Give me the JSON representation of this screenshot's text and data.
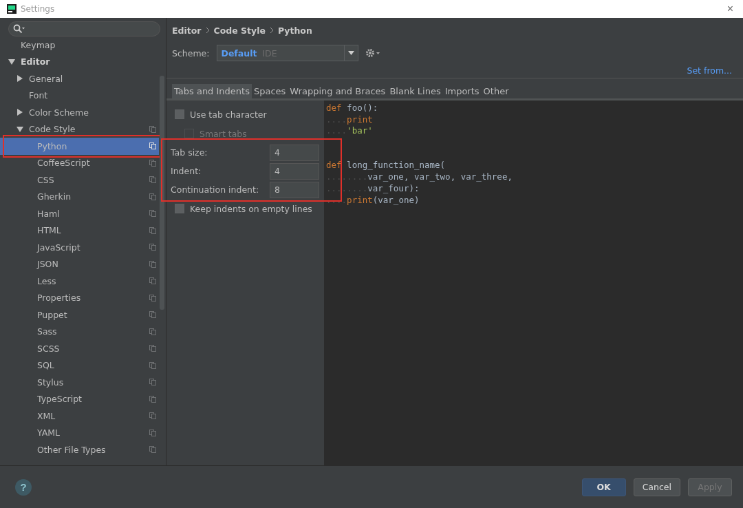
{
  "window": {
    "title": "Settings",
    "close": "×"
  },
  "breadcrumb": [
    "Editor",
    "Code Style",
    "Python"
  ],
  "scheme": {
    "label": "Scheme:",
    "value": "Default",
    "suffix": "IDE",
    "link": "Set from..."
  },
  "tree": [
    {
      "label": "Keymap",
      "selected": false,
      "highlighted": false,
      "modified": false
    },
    {
      "label": "Editor",
      "selected": false,
      "highlighted": false,
      "modified": false,
      "expanded": true,
      "children": [
        {
          "label": "General",
          "selected": false,
          "highlighted": false,
          "modified": false,
          "expanded": false
        },
        {
          "label": "Font",
          "selected": false,
          "highlighted": false,
          "modified": false
        },
        {
          "label": "Color Scheme",
          "selected": false,
          "highlighted": false,
          "modified": false,
          "expanded": false
        },
        {
          "label": "Code Style",
          "selected": false,
          "highlighted": false,
          "modified": true,
          "expanded": true,
          "children": [
            {
              "label": "Python",
              "selected": true,
              "highlighted": true,
              "modified": true
            },
            {
              "label": "CoffeeScript",
              "selected": false,
              "highlighted": false,
              "modified": true
            },
            {
              "label": "CSS",
              "selected": false,
              "highlighted": false,
              "modified": true
            },
            {
              "label": "Gherkin",
              "selected": false,
              "highlighted": false,
              "modified": true
            },
            {
              "label": "Haml",
              "selected": false,
              "highlighted": false,
              "modified": true
            },
            {
              "label": "HTML",
              "selected": false,
              "highlighted": false,
              "modified": true
            },
            {
              "label": "JavaScript",
              "selected": false,
              "highlighted": false,
              "modified": true
            },
            {
              "label": "JSON",
              "selected": false,
              "highlighted": false,
              "modified": true
            },
            {
              "label": "Less",
              "selected": false,
              "highlighted": false,
              "modified": true
            },
            {
              "label": "Properties",
              "selected": false,
              "highlighted": false,
              "modified": true
            },
            {
              "label": "Puppet",
              "selected": false,
              "highlighted": false,
              "modified": true
            },
            {
              "label": "Sass",
              "selected": false,
              "highlighted": false,
              "modified": true
            },
            {
              "label": "SCSS",
              "selected": false,
              "highlighted": false,
              "modified": true
            },
            {
              "label": "SQL",
              "selected": false,
              "highlighted": false,
              "modified": true
            },
            {
              "label": "Stylus",
              "selected": false,
              "highlighted": false,
              "modified": true
            },
            {
              "label": "TypeScript",
              "selected": false,
              "highlighted": false,
              "modified": true
            },
            {
              "label": "XML",
              "selected": false,
              "highlighted": false,
              "modified": true
            },
            {
              "label": "YAML",
              "selected": false,
              "highlighted": false,
              "modified": true
            },
            {
              "label": "Other File Types",
              "selected": false,
              "highlighted": false,
              "modified": true
            }
          ]
        }
      ]
    }
  ],
  "tabs": [
    {
      "label": "Tabs and Indents",
      "selected": true
    },
    {
      "label": "Spaces",
      "selected": false
    },
    {
      "label": "Wrapping and Braces",
      "selected": false
    },
    {
      "label": "Blank Lines",
      "selected": false
    },
    {
      "label": "Imports",
      "selected": false
    },
    {
      "label": "Other",
      "selected": false
    }
  ],
  "options_top": [
    {
      "label": "Use tab character",
      "checked": false,
      "disabled": false,
      "nested": false
    },
    {
      "label": "Smart tabs",
      "checked": false,
      "disabled": true,
      "nested": true
    }
  ],
  "indent_fields": {
    "highlighted": true,
    "fields": [
      {
        "label": "Tab size:",
        "value": "4"
      },
      {
        "label": "Indent:",
        "value": "4"
      },
      {
        "label": "Continuation indent:",
        "value": "8"
      }
    ]
  },
  "options_bottom": [
    {
      "label": "Keep indents on empty lines",
      "checked": false,
      "disabled": false,
      "nested": false
    }
  ],
  "code": [
    [
      [
        {
          "kind": "keyword",
          "text": "def"
        },
        {
          "kind": "plain",
          "text": " foo():"
        }
      ],
      [
        {
          "kind": "space",
          "text": "...."
        },
        {
          "kind": "keyword",
          "text": "print"
        }
      ],
      [
        {
          "kind": "space",
          "text": "...."
        },
        {
          "kind": "string",
          "text": "'bar'"
        }
      ]
    ],
    [
      [
        {
          "kind": "keyword",
          "text": "def"
        },
        {
          "kind": "plain",
          "text": " long_function_name("
        }
      ],
      [
        {
          "kind": "space",
          "text": "........"
        },
        {
          "kind": "plain",
          "text": "var_one, var_two, var_three,"
        }
      ],
      [
        {
          "kind": "space",
          "text": "........"
        },
        {
          "kind": "plain",
          "text": "var_four):"
        }
      ],
      [
        {
          "kind": "space",
          "text": "...."
        },
        {
          "kind": "keyword",
          "text": "print"
        },
        {
          "kind": "plain",
          "text": "(var_one)"
        }
      ]
    ]
  ],
  "footer": {
    "help": "?",
    "buttons": [
      {
        "label": "OK",
        "kind": "primary"
      },
      {
        "label": "Cancel",
        "kind": "normal"
      },
      {
        "label": "Apply",
        "kind": "disabled"
      }
    ]
  }
}
